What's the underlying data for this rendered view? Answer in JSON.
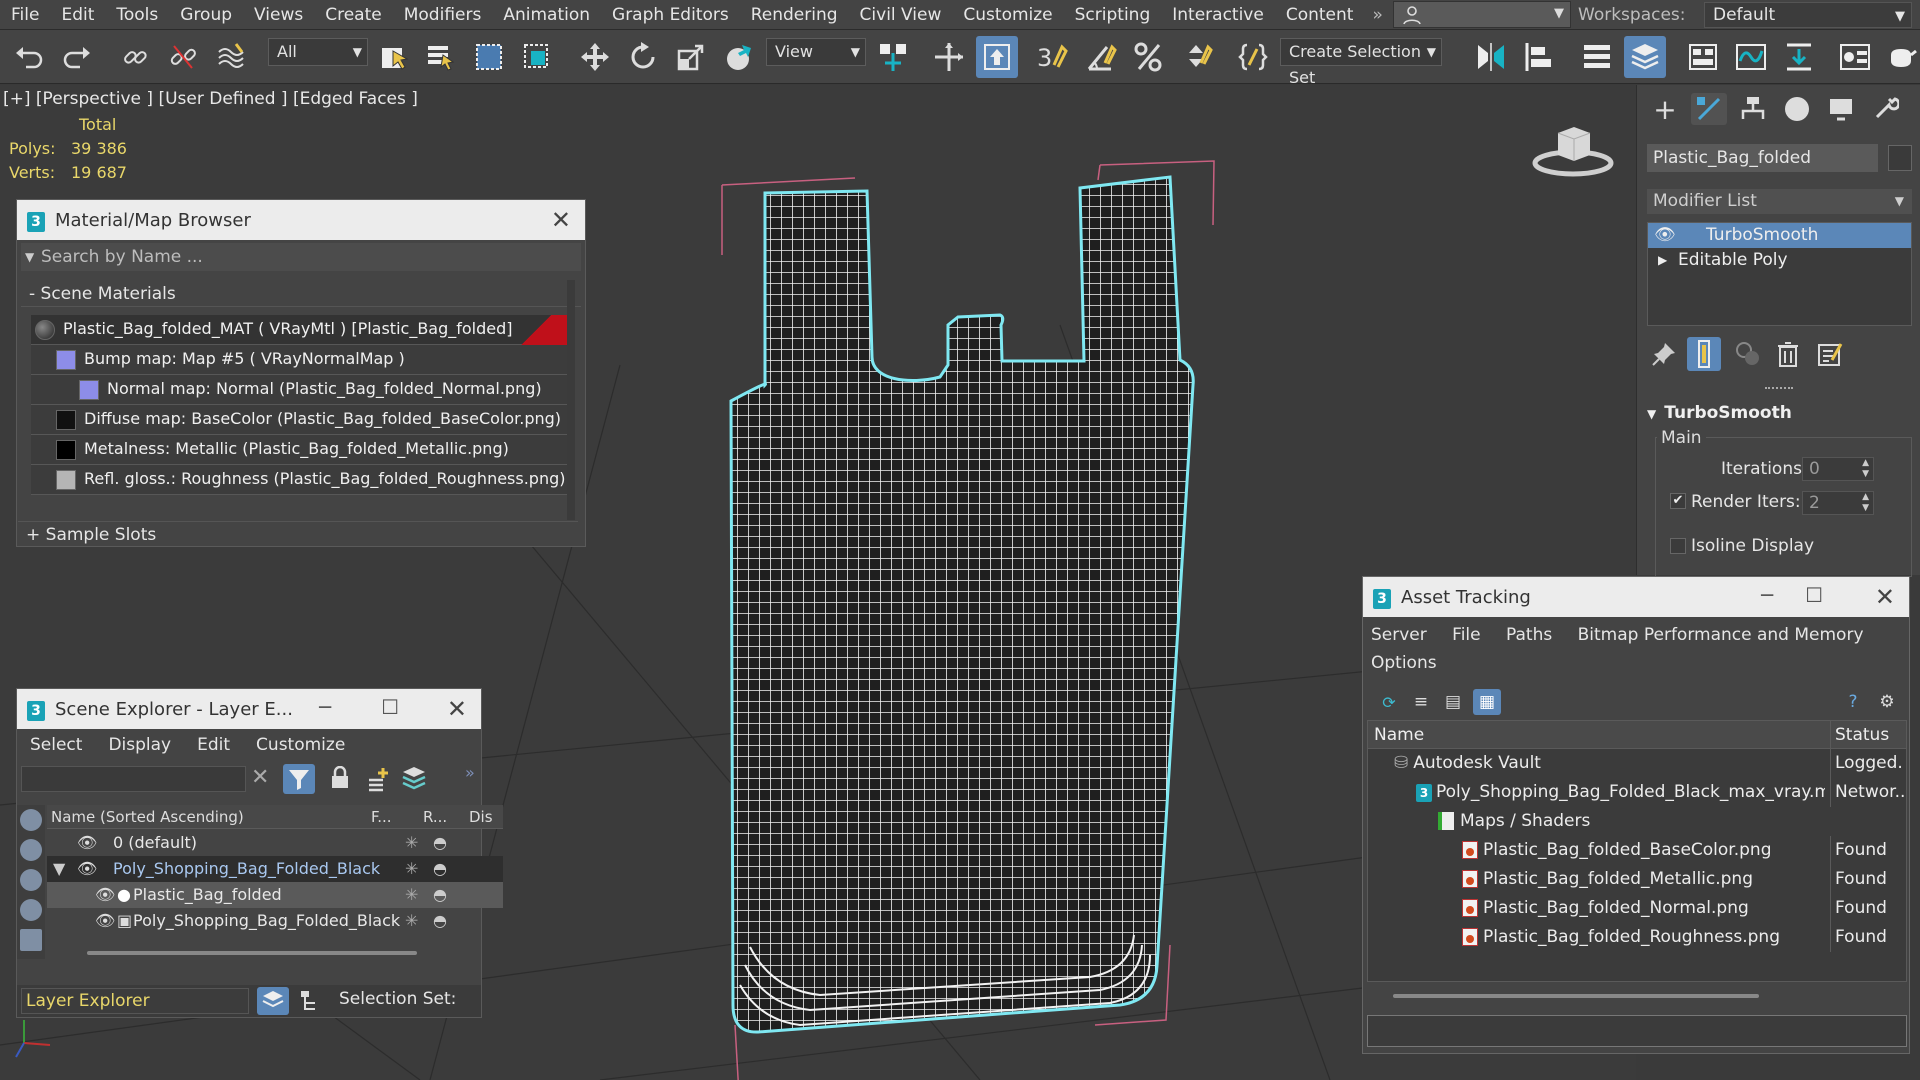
{
  "menu": [
    "File",
    "Edit",
    "Tools",
    "Group",
    "Views",
    "Create",
    "Modifiers",
    "Animation",
    "Graph Editors",
    "Rendering",
    "Civil View",
    "Customize",
    "Scripting",
    "Interactive",
    "Content"
  ],
  "menu_more": "»",
  "workspace": {
    "label": "Workspaces:",
    "value": "Default"
  },
  "toolbar": {
    "selection_filter": "All",
    "ref_coord": "View",
    "snap_label": "3",
    "named_selection": "Create Selection Set"
  },
  "viewport": {
    "label": "[+] [Perspective ] [User Defined ] [Edged Faces ]",
    "stats": {
      "header": "Total",
      "polys_label": "Polys:",
      "polys": "39 386",
      "verts_label": "Verts:",
      "verts": "19 687"
    },
    "colors": {
      "wire_outline": "#7fe8f2",
      "wire_fill": "#ffffff",
      "bbox": "#c86080",
      "bg": "#3b3b3b"
    }
  },
  "material_browser": {
    "title": "Material/Map Browser",
    "search_placeholder": "Search by Name ...",
    "group": "- Scene Materials",
    "rows": [
      "Plastic_Bag_folded_MAT  ( VRayMtl )  [Plastic_Bag_folded]",
      "Bump map: Map #5  ( VRayNormalMap )",
      "Normal map: Normal (Plastic_Bag_folded_Normal.png)",
      "Diffuse map: BaseColor (Plastic_Bag_folded_BaseColor.png)",
      "Metalness: Metallic (Plastic_Bag_folded_Metallic.png)",
      "Refl. gloss.: Roughness (Plastic_Bag_folded_Roughness.png)"
    ],
    "sample_slots": "+ Sample Slots"
  },
  "scene_explorer": {
    "title": "Scene Explorer - Layer E...",
    "menu": [
      "Select",
      "Display",
      "Edit",
      "Customize"
    ],
    "columns": {
      "name": "Name (Sorted Ascending)",
      "f": "F...",
      "r": "R...",
      "d": "Dis"
    },
    "rows": [
      "0 (default)",
      "Poly_Shopping_Bag_Folded_Black",
      "Plastic_Bag_folded",
      "Poly_Shopping_Bag_Folded_Black"
    ],
    "layer_explorer": "Layer Explorer",
    "selection_set": "Selection Set:"
  },
  "command_panel": {
    "object_name": "Plastic_Bag_folded",
    "modifier_list": "Modifier List",
    "stack": [
      "TurboSmooth",
      "Editable Poly"
    ],
    "rollout": "TurboSmooth",
    "main": "Main",
    "iterations_label": "Iterations:",
    "iterations": "0",
    "render_iters_label": "Render Iters:",
    "render_iters": "2",
    "isoline": "Isoline Display"
  },
  "asset_tracking": {
    "title": "Asset Tracking",
    "menu": [
      "Server",
      "File",
      "Paths",
      "Bitmap Performance and Memory",
      "Options"
    ],
    "columns": {
      "name": "Name",
      "status": "Status"
    },
    "rows": [
      {
        "name": "Autodesk Vault",
        "status": "Logged..."
      },
      {
        "name": "Poly_Shopping_Bag_Folded_Black_max_vray.max",
        "status": "Networ..."
      },
      {
        "name": "Maps / Shaders",
        "status": ""
      },
      {
        "name": "Plastic_Bag_folded_BaseColor.png",
        "status": "Found"
      },
      {
        "name": "Plastic_Bag_folded_Metallic.png",
        "status": "Found"
      },
      {
        "name": "Plastic_Bag_folded_Normal.png",
        "status": "Found"
      },
      {
        "name": "Plastic_Bag_folded_Roughness.png",
        "status": "Found"
      }
    ]
  },
  "accent": "#5b87b8"
}
